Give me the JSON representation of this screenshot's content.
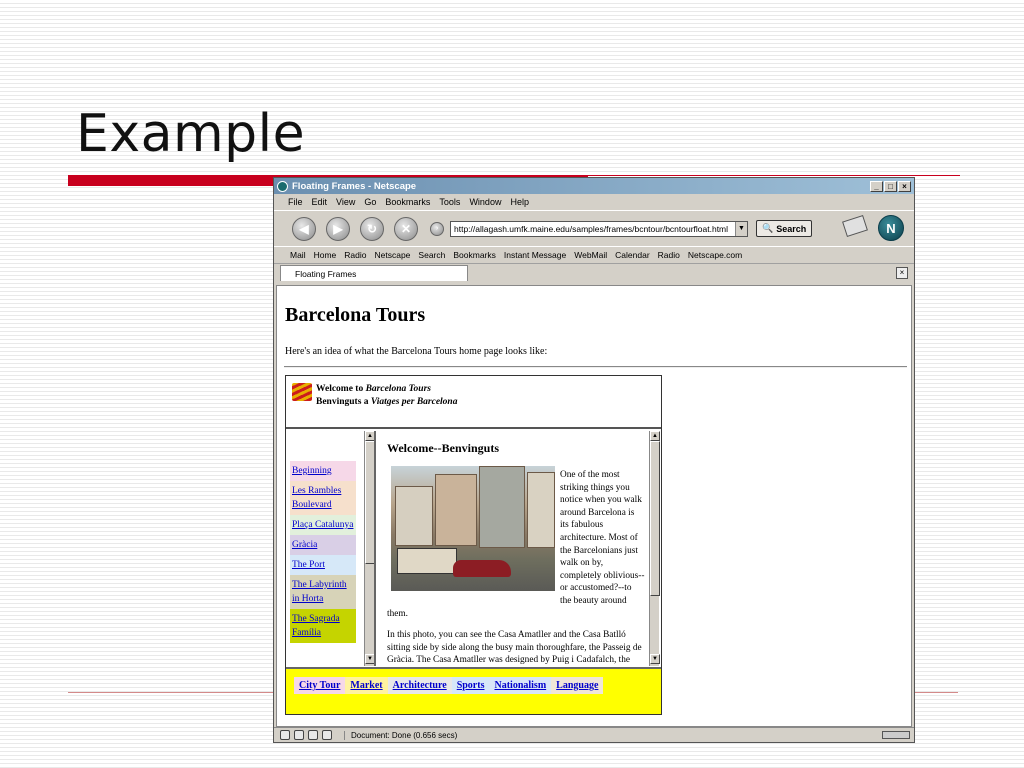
{
  "slide": {
    "title": "Example"
  },
  "window": {
    "title": "Floating Frames - Netscape",
    "controls": [
      "_",
      "□",
      "×"
    ]
  },
  "menu": [
    "File",
    "Edit",
    "View",
    "Go",
    "Bookmarks",
    "Tools",
    "Window",
    "Help"
  ],
  "nav": {
    "url": "http://allagash.umfk.maine.edu/samples/frames/bcntour/bcntourfloat.html",
    "search_label": "Search",
    "throbber_letter": "N"
  },
  "personal_bar": [
    "Mail",
    "Home",
    "Radio",
    "Netscape",
    "Search",
    "Bookmarks",
    "Instant Message",
    "WebMail",
    "Calendar",
    "Radio",
    "Netscape.com"
  ],
  "tab": {
    "label": "Floating Frames",
    "close": "×"
  },
  "page": {
    "heading": "Barcelona Tours",
    "intro": "Here's an idea of what the Barcelona Tours home page looks like:"
  },
  "demo": {
    "welcome_prefix": "Welcome to ",
    "welcome_name": "Barcelona Tours",
    "benv_prefix": "Benvinguts a ",
    "benv_name": "Viatges per Barcelona",
    "left_links": [
      "Beginning",
      "Les Rambles Boulevard",
      "Plaça Catalunya",
      "Gràcia",
      "The Port",
      "The Labyrinth in Horta",
      "The Sagrada Família"
    ],
    "left_link_colors": [
      "#f6d8e8",
      "#f6e0cc",
      "#e2f0dc",
      "#d9cfe6",
      "#d6e8f8",
      "#d7d3b8",
      "#c5d400"
    ],
    "main_heading": "Welcome--Benvinguts",
    "para1": "One of the most striking things you notice when you walk around Barcelona is its fabulous architecture. Most of the Barcelonians just walk on by, completely oblivious--or accustomed?--to the beauty around them.",
    "para2": "In this photo, you can see the Casa Amatller and the Casa Batlló sitting side by side along the busy main thoroughfare, the Passeig de Gràcia. The Casa Amatller was designed by Puig i Cadafalch, the same architect responsible for the",
    "bottom_links": [
      "City Tour",
      "Market",
      "Architecture",
      "Sports",
      "Nationalism",
      "Language"
    ],
    "bottom_link_colors": [
      "#f6d8e8",
      "#fff3a0",
      "#e8e8e8",
      "#d6e8f8",
      "#d9e6f8",
      "#f0e6d8"
    ]
  },
  "status": {
    "text": "Document: Done (0.656 secs)"
  }
}
